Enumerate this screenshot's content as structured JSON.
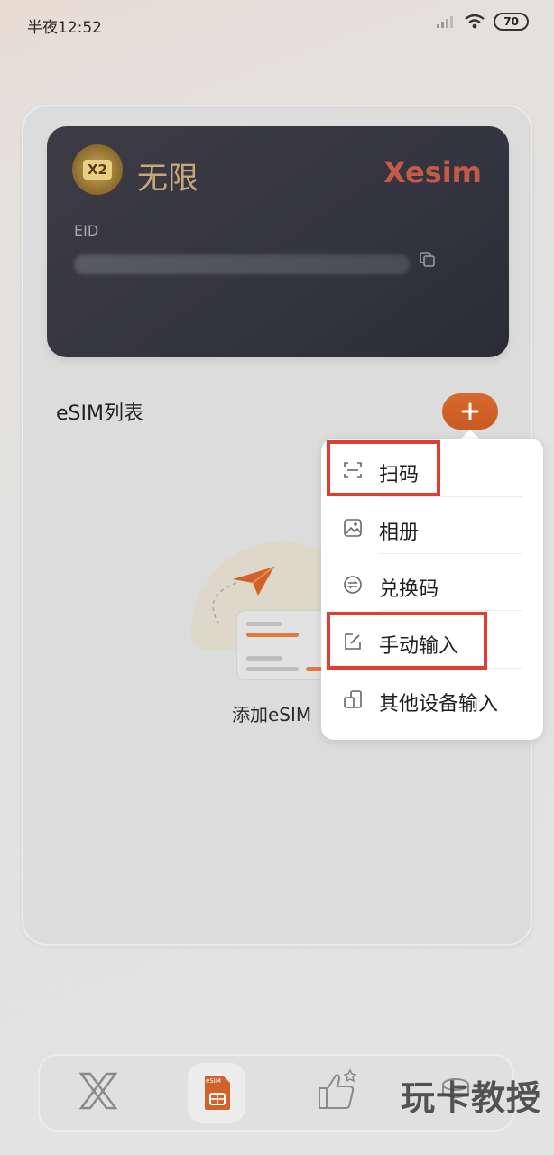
{
  "status_bar": {
    "time": "半夜12:52",
    "battery": "70"
  },
  "card": {
    "plan_name": "无限",
    "brand": "Xesim",
    "eid_label": "EID",
    "badge_text": "X2"
  },
  "esim_list": {
    "title": "eSIM列表",
    "empty_text": "添加eSIM"
  },
  "menu": {
    "items": [
      {
        "label": "扫码",
        "icon": "scan-icon"
      },
      {
        "label": "相册",
        "icon": "album-icon"
      },
      {
        "label": "兑换码",
        "icon": "redeem-icon"
      },
      {
        "label": "手动输入",
        "icon": "edit-icon"
      },
      {
        "label": "其他设备输入",
        "icon": "other-device-icon"
      }
    ]
  },
  "bottom_nav": {
    "items": [
      {
        "label": "",
        "icon": "x-logo-icon"
      },
      {
        "label": "eSIM",
        "icon": "sim-card-icon"
      },
      {
        "label": "",
        "icon": "thumbs-up-icon"
      },
      {
        "label": "",
        "icon": "coins-icon"
      }
    ]
  },
  "watermark": "玩卡教授",
  "colors": {
    "accent": "#d2622a",
    "highlight": "#e33c33",
    "card_bg": "#3a3a44",
    "plan_gold": "#c7a877"
  }
}
